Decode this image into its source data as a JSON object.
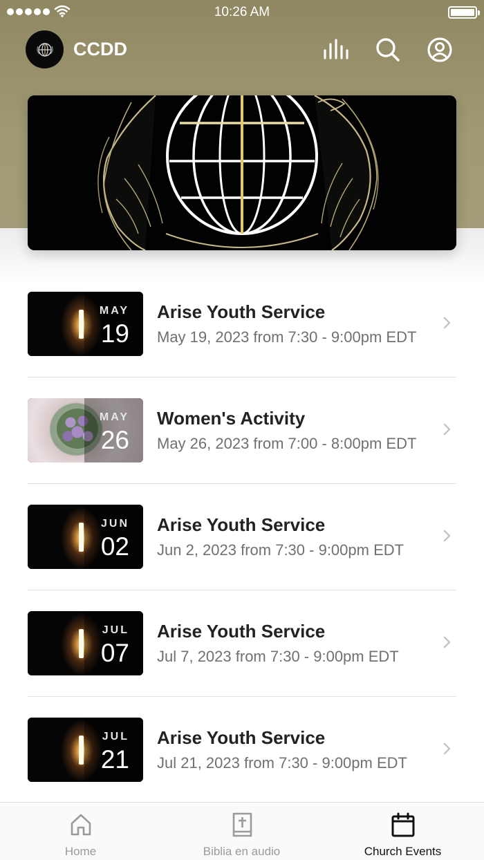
{
  "status_bar": {
    "time": "10:26 AM"
  },
  "header": {
    "title": "CCDD"
  },
  "events": [
    {
      "month": "MAY",
      "day": "19",
      "title": "Arise Youth Service",
      "subtitle": "May 19, 2023 from 7:30 - 9:00pm EDT",
      "image": "candle"
    },
    {
      "month": "MAY",
      "day": "26",
      "title": "Women's Activity",
      "subtitle": "May 26, 2023 from 7:00 - 8:00pm EDT",
      "image": "flowers"
    },
    {
      "month": "JUN",
      "day": "02",
      "title": "Arise Youth Service",
      "subtitle": "Jun 2, 2023 from 7:30 - 9:00pm EDT",
      "image": "candle"
    },
    {
      "month": "JUL",
      "day": "07",
      "title": "Arise Youth Service",
      "subtitle": "Jul 7, 2023 from 7:30 - 9:00pm EDT",
      "image": "candle"
    },
    {
      "month": "JUL",
      "day": "21",
      "title": "Arise Youth Service",
      "subtitle": "Jul 21, 2023 from 7:30 - 9:00pm EDT",
      "image": "candle"
    }
  ],
  "tabs": [
    {
      "label": "Home",
      "icon": "home-icon",
      "active": false
    },
    {
      "label": "Biblia en audio",
      "icon": "bible-icon",
      "active": false
    },
    {
      "label": "Church Events",
      "icon": "calendar-icon",
      "active": true
    }
  ],
  "colors": {
    "header_bg": "#9a9270",
    "active_tab": "#111111",
    "inactive_tab": "#9a9a9a"
  }
}
